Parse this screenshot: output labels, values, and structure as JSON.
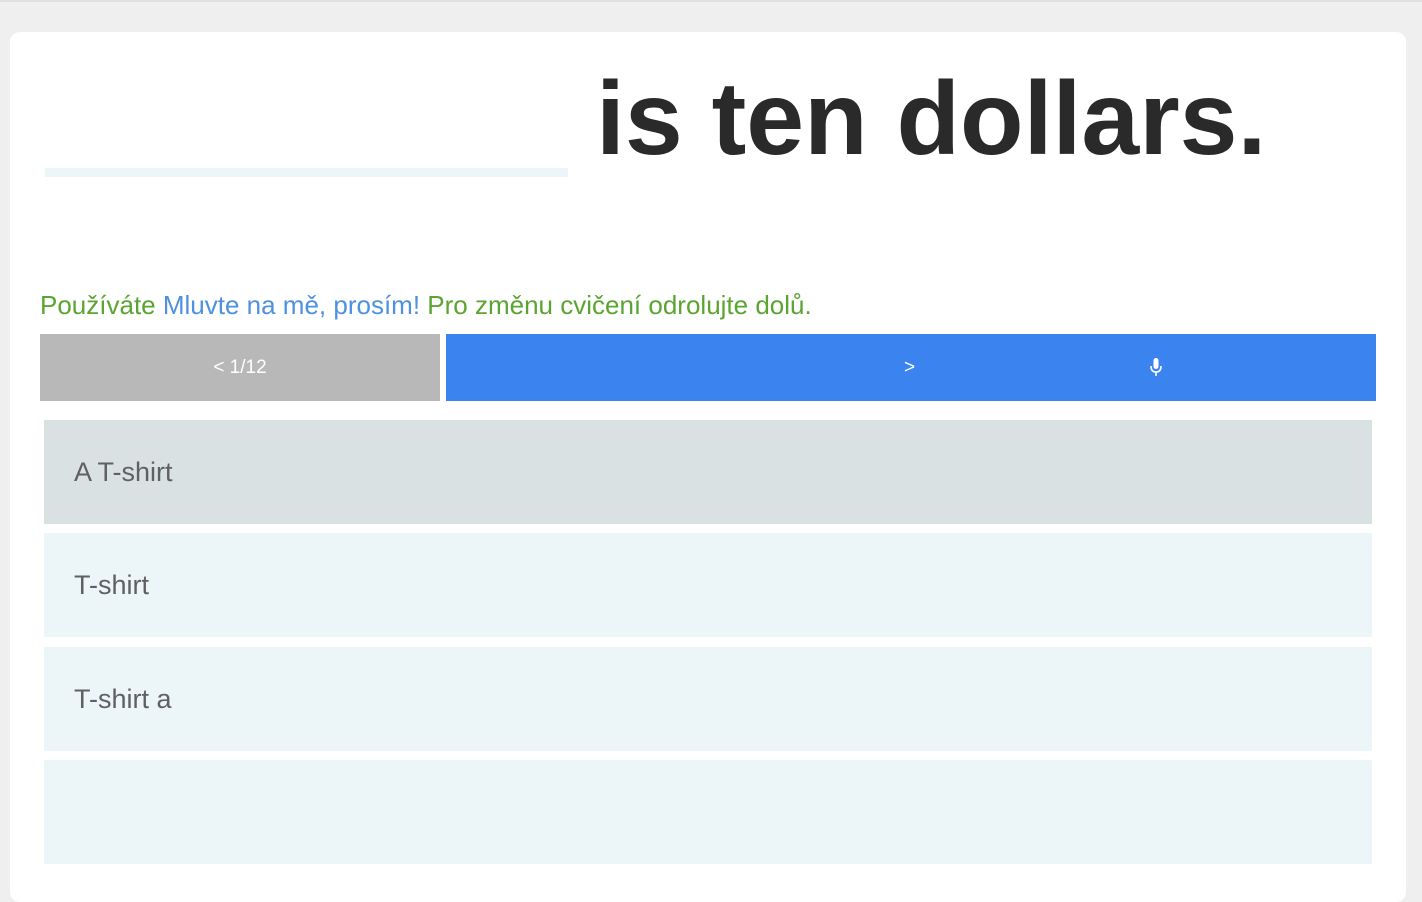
{
  "exercise": {
    "sentence_rest": "is ten dollars."
  },
  "info": {
    "prefix": "Používáte ",
    "app_name": "Mluvte na mě, prosím!",
    "suffix": " Pro změnu cvičení odrolujte dolů."
  },
  "nav": {
    "prev_label": "< 1/12",
    "next_label": ">",
    "mic_icon": "microphone-icon"
  },
  "options": [
    {
      "label": "A T-shirt",
      "selected": true
    },
    {
      "label": "T-shirt",
      "selected": false
    },
    {
      "label": "T-shirt a",
      "selected": false
    },
    {
      "label": "",
      "selected": false
    }
  ],
  "colors": {
    "info_text": "#5aa531",
    "app_link": "#4d91e0",
    "next_button": "#3b84f0",
    "prev_button": "#b8b8b8",
    "option_bg": "#ecf5f8",
    "option_selected_bg": "#d9e1e3"
  }
}
